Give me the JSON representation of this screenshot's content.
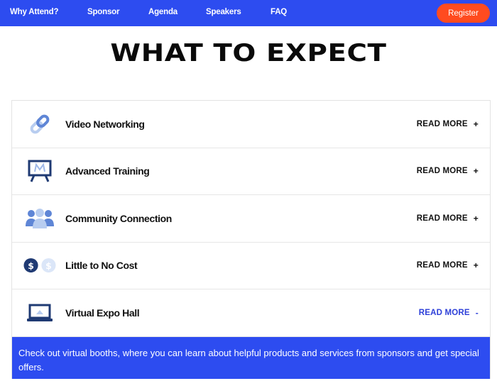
{
  "nav": {
    "links": [
      "Why Attend?",
      "Sponsor",
      "Agenda",
      "Speakers",
      "FAQ"
    ],
    "register_label": "Register"
  },
  "section": {
    "title": "WHAT TO EXPECT"
  },
  "accordion": {
    "items": [
      {
        "label": "Video Networking",
        "action": "READ MORE",
        "toggle": "+",
        "icon": "link-icon"
      },
      {
        "label": "Advanced Training",
        "action": "READ MORE",
        "toggle": "+",
        "icon": "presentation-board-icon"
      },
      {
        "label": "Community Connection",
        "action": "READ MORE",
        "toggle": "+",
        "icon": "people-group-icon"
      },
      {
        "label": "Little to No Cost",
        "action": "READ MORE",
        "toggle": "+",
        "icon": "dollar-coins-icon"
      },
      {
        "label": "Virtual Expo Hall",
        "action": "READ MORE",
        "toggle": "-",
        "icon": "laptop-icon"
      }
    ],
    "open_panel_text": "Check out virtual booths, where you can learn about helpful products and services from sponsors and get special offers."
  },
  "colors": {
    "brand_blue": "#2d4cf0",
    "register_orange": "#ff4b1f",
    "icon_dark": "#1f3a73",
    "icon_light": "#b8cdf0"
  }
}
